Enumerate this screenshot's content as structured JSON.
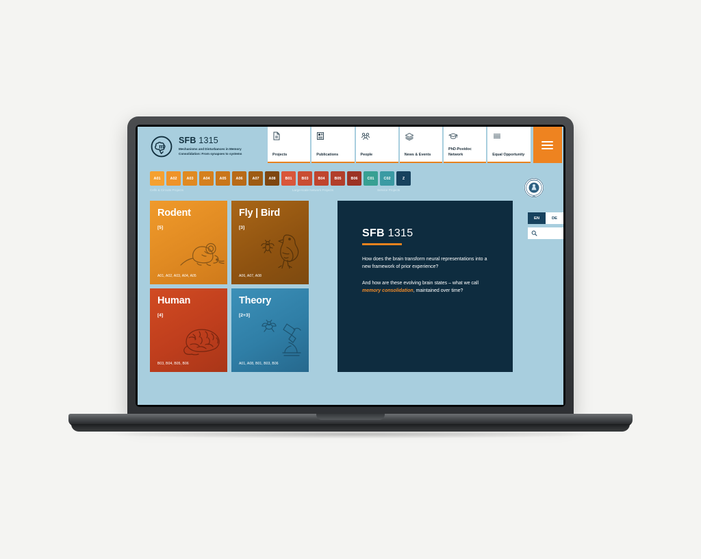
{
  "brand": {
    "logo_icon": "sfb-brain-monogram-icon",
    "title_main": "SFB",
    "title_number": "1315",
    "subtitle": "Mechanisms and Disturbances in Memory Consolidation: From synapses to systems"
  },
  "nav": {
    "items": [
      {
        "label": "Projects",
        "icon": "document-icon",
        "glyph": "὜E"
      },
      {
        "label": "Publications",
        "icon": "book-icon",
        "glyph": "▤"
      },
      {
        "label": "People",
        "icon": "people-group-icon",
        "glyph": "☸"
      },
      {
        "label": "News & Events",
        "icon": "newspaper-icon",
        "glyph": "▧"
      },
      {
        "label": "PhD-Postdoc Network",
        "icon": "graduation-cap-icon",
        "glyph": "☁"
      },
      {
        "label": "Equal Opportunity",
        "icon": "list-lines-icon",
        "glyph": "≡"
      }
    ],
    "menu_button": {
      "name": "hamburger-menu-button",
      "color": "#ee8320"
    }
  },
  "project_tags": {
    "tags": [
      {
        "label": "A01",
        "color": "#f5a030"
      },
      {
        "label": "A02",
        "color": "#ef9329"
      },
      {
        "label": "A03",
        "color": "#e08a22"
      },
      {
        "label": "A04",
        "color": "#d5801e"
      },
      {
        "label": "A05",
        "color": "#c9761a"
      },
      {
        "label": "A06",
        "color": "#b86a17"
      },
      {
        "label": "A07",
        "color": "#9e5b13"
      },
      {
        "label": "A08",
        "color": "#7e4610"
      },
      {
        "label": "B01",
        "color": "#d9563a"
      },
      {
        "label": "B03",
        "color": "#c94d33"
      },
      {
        "label": "B04",
        "color": "#bf452e"
      },
      {
        "label": "B05",
        "color": "#b23e2a"
      },
      {
        "label": "B06",
        "color": "#9c3324"
      },
      {
        "label": "C01",
        "color": "#37a093"
      },
      {
        "label": "C02",
        "color": "#3a9aa3"
      },
      {
        "label": "Z",
        "color": "#17425e"
      }
    ],
    "captions": {
      "a": "Cells & Circuits Projects",
      "b": "Large-scale Network Projects",
      "c": "Service Projects"
    }
  },
  "right_rail": {
    "seal_icon": "university-seal-icon",
    "languages": [
      {
        "code": "EN",
        "active": true
      },
      {
        "code": "DE",
        "active": false
      }
    ],
    "search": {
      "icon": "search-icon",
      "value": "",
      "placeholder": ""
    }
  },
  "cards": [
    {
      "id": "rodent",
      "title": "Rodent",
      "count": "[5]",
      "projects": "A01, A02, A03, A04, A05",
      "art_icon": "mouse-illustration-icon",
      "color": "#e08a22"
    },
    {
      "id": "flybird",
      "title": "Fly | Bird",
      "count": "[3]",
      "projects": "A06, A07, A08",
      "art_icon": "bird-and-fly-illustration-icon",
      "color": "#8e5210"
    },
    {
      "id": "human",
      "title": "Human",
      "count": "[4]",
      "projects": "B03, B04, B05, B06",
      "art_icon": "brain-illustration-icon",
      "color": "#bf3e1d"
    },
    {
      "id": "theory",
      "title": "Theory",
      "count": "[2+3]",
      "projects": "A01, A08, B01, B03, B06",
      "art_icon": "microscope-illustration-icon",
      "color": "#2f7ea6"
    }
  ],
  "hero": {
    "title_main": "SFB",
    "title_number": "1315",
    "paragraph_1": "How does the brain transform neural representations into a new framework of prior experience?",
    "paragraph_2_before": "And how are these evolving brain states – what we call ",
    "paragraph_2_emphasis": "memory consolidation",
    "paragraph_2_after": ", maintained over time?",
    "accent_color": "#e8821e",
    "background_color": "#0e2c3f"
  }
}
